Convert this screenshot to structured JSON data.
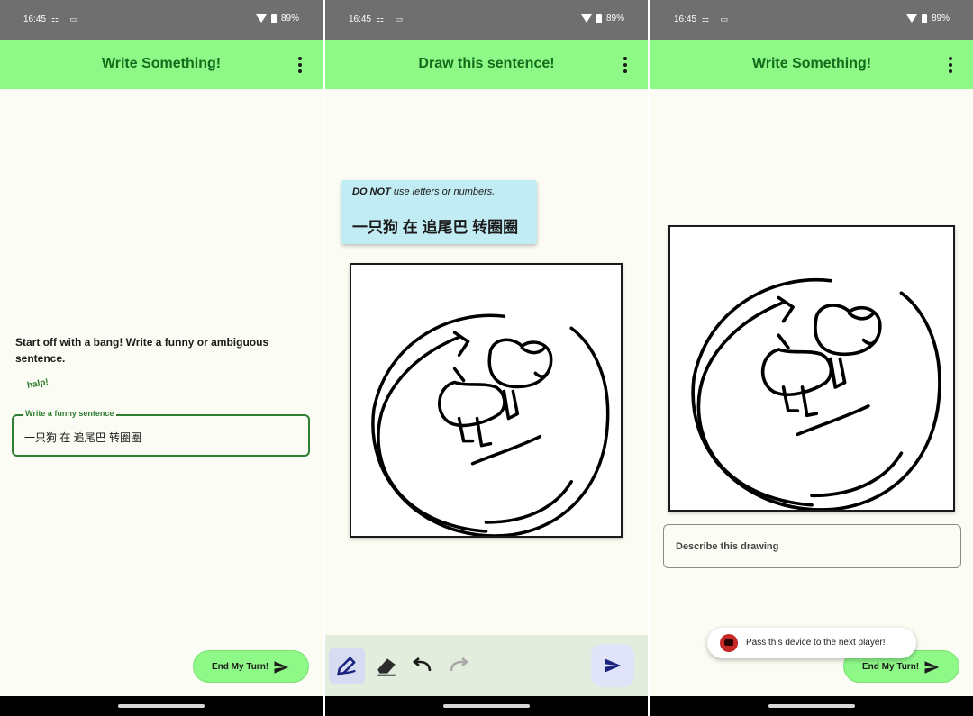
{
  "status": {
    "time": "16:45",
    "glyphs": "⚏ ▭",
    "battery": "89%"
  },
  "screen1": {
    "title": "Write Something!",
    "prompt": "Start off with a bang! Write a funny or ambiguous sentence.",
    "badge": "halp!",
    "field_label": "Write a funny sentence",
    "field_value": "一只狗 在 追尾巴 转圈圈",
    "end_turn_label": "End My Turn!"
  },
  "screen2": {
    "title": "Draw this sentence!",
    "warning_bold": "DO NOT",
    "warning_rest": " use letters or numbers.",
    "sentence": "一只狗 在 追尾巴 转圈圈",
    "tools": [
      "pen-icon",
      "eraser-icon",
      "undo-icon",
      "redo-icon"
    ],
    "send_icon": "send-icon"
  },
  "screen3": {
    "title": "Write Something!",
    "describe_placeholder": "Describe this drawing",
    "toast_text": "Pass this device to the next player!",
    "end_turn_label": "End My Turn!"
  },
  "colors": {
    "appbar": "#8ff988",
    "title": "#146c1c",
    "field_border": "#2f7d32",
    "card": "#c2ecf4",
    "toolbar": "#e3eddd",
    "background": "#fbfdf4"
  },
  "icons": {
    "overflow": "more-vert-icon",
    "wifi": "wifi-icon",
    "battery": "battery-icon",
    "send": "send-icon",
    "toast": "game-controller-icon"
  }
}
